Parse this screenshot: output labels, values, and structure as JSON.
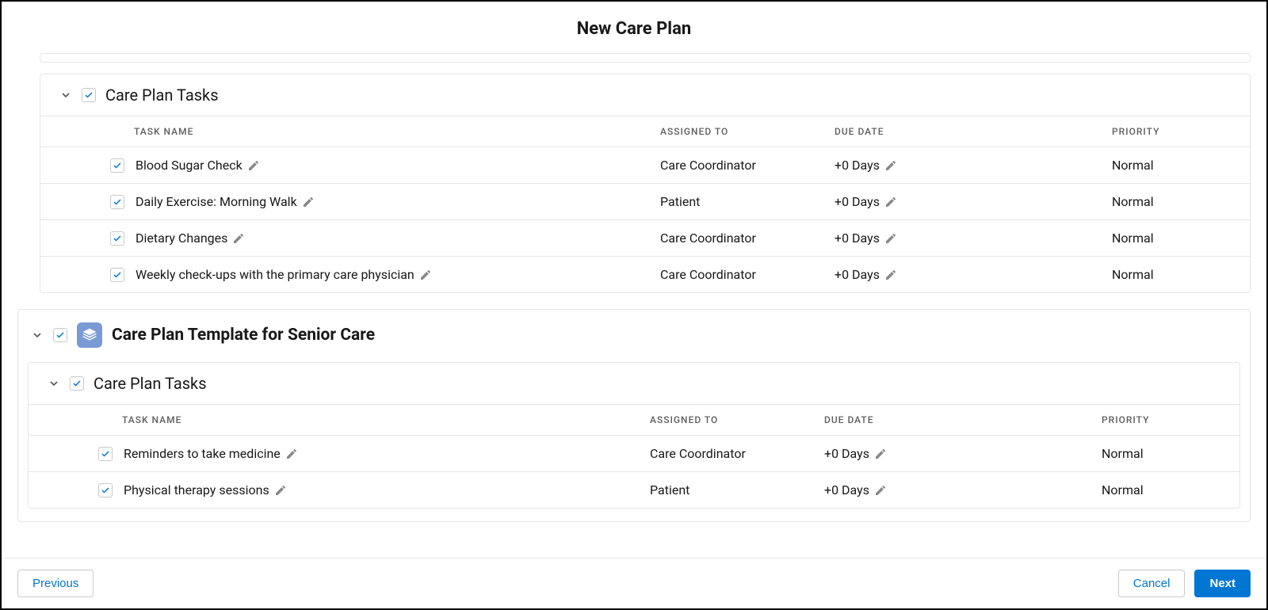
{
  "header": {
    "title": "New Care Plan"
  },
  "columns": {
    "name": "TASK NAME",
    "assigned": "ASSIGNED TO",
    "due": "DUE DATE",
    "priority": "PRIORITY"
  },
  "section1": {
    "title": "Care Plan Tasks",
    "rows": [
      {
        "name": "Blood Sugar Check",
        "assigned": "Care Coordinator",
        "due": "+0 Days",
        "priority": "Normal"
      },
      {
        "name": "Daily Exercise: Morning Walk",
        "assigned": "Patient",
        "due": "+0 Days",
        "priority": "Normal"
      },
      {
        "name": "Dietary Changes",
        "assigned": "Care Coordinator",
        "due": "+0 Days",
        "priority": "Normal"
      },
      {
        "name": "Weekly check-ups with the primary care physician",
        "assigned": "Care Coordinator",
        "due": "+0 Days",
        "priority": "Normal"
      }
    ]
  },
  "group2": {
    "title": "Care Plan Template for Senior Care",
    "section": {
      "title": "Care Plan Tasks",
      "rows": [
        {
          "name": "Reminders to take medicine",
          "assigned": "Care Coordinator",
          "due": "+0 Days",
          "priority": "Normal"
        },
        {
          "name": "Physical therapy sessions",
          "assigned": "Patient",
          "due": "+0 Days",
          "priority": "Normal"
        }
      ]
    }
  },
  "footer": {
    "previous": "Previous",
    "cancel": "Cancel",
    "next": "Next"
  }
}
